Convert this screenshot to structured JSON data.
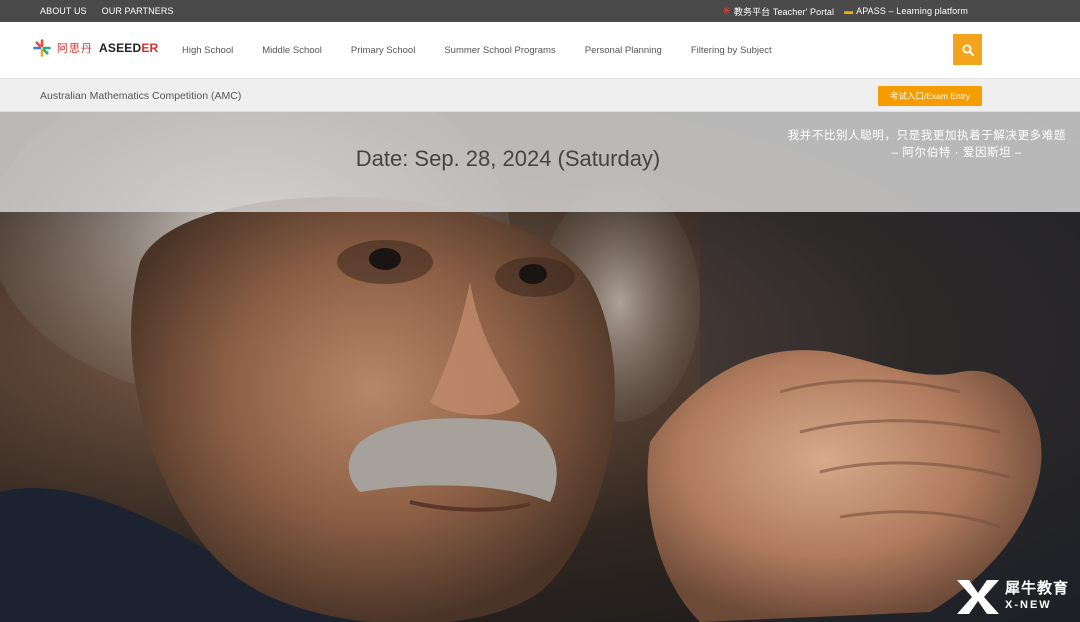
{
  "topbar": {
    "about": "ABOUT US",
    "partners": "OUR PARTNERS",
    "teacher_portal": "教务平台 Teacher' Portal",
    "apass": "APASS – Learning platform"
  },
  "header": {
    "logo_cn": "阿思丹",
    "logo_en_a": "ASEED",
    "logo_en_b": "ER",
    "nav": [
      "High School",
      "Middle School",
      "Primary School",
      "Summer School Programs",
      "Personal Planning",
      "Filtering by Subject"
    ]
  },
  "crumb": {
    "title": "Australian Mathematics Competition (AMC)",
    "exam_button": "考试入口/Exam Entry"
  },
  "hero": {
    "date": "Date: Sep. 28, 2024 (Saturday)",
    "quote": "我并不比别人聪明，只是我更加执着于解决更多难题",
    "attribution": "– 阿尔伯特 · 爱因斯坦 –"
  },
  "watermark": {
    "cn": "犀牛教育",
    "en": "X-NEW"
  },
  "colors": {
    "accent": "#f2a41c",
    "exam": "#f59d00",
    "topbar": "#4a4a4a"
  },
  "icons": [
    "search-icon",
    "aseeder-star-icon",
    "xnew-logo-icon"
  ]
}
